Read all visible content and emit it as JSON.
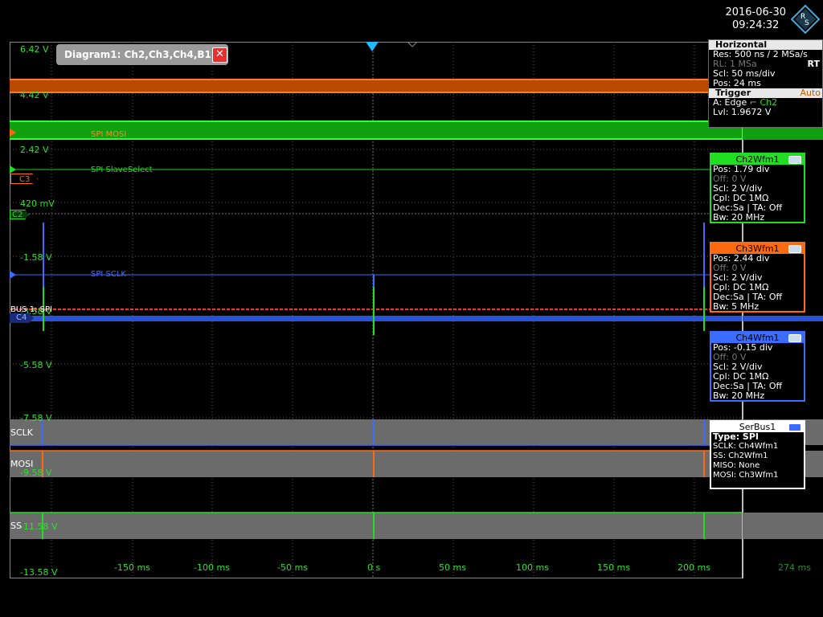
{
  "header": {
    "date": "2016-06-30",
    "time": "09:24:32"
  },
  "diagram": {
    "title": "Diagram1: Ch2,Ch3,Ch4,B1",
    "close_glyph": "✕"
  },
  "y_labels": [
    "6.42 V",
    "4.42 V",
    "2.42 V",
    "420 mV",
    "-1.58 V",
    "-3.58 V",
    "-5.58 V",
    "-7.58 V",
    "-9.58 V",
    "-11.58 V",
    "-13.58 V"
  ],
  "x_labels": [
    "-150 ms",
    "-100 ms",
    "-50 ms",
    "0 s",
    "50 ms",
    "100 ms",
    "150 ms",
    "200 ms",
    "274 ms"
  ],
  "wave_labels": {
    "mosi": "SPI MOSI",
    "slave_select": "SPI SlaveSelect",
    "sclk": "SPI SCLK",
    "bus": "BUS 1: SPI"
  },
  "markers": {
    "c3": "C3",
    "c2": "C2",
    "c4": "C4"
  },
  "bus_lanes": {
    "sclk": "SCLK",
    "mosi": "MOSI",
    "ss": "SS"
  },
  "horizontal": {
    "title": "Horizontal",
    "res": "Res: 500 ns / 2 MSa/s",
    "rl": "RL:  1 MSa",
    "rt": "RT",
    "scl": "Scl: 50 ms/div",
    "pos": "Pos: 24 ms"
  },
  "trigger": {
    "title": "Trigger",
    "mode": "Auto",
    "source": "A:   Edge",
    "channel": "Ch2",
    "level": "Lvl:  1.9672 V"
  },
  "ch2": {
    "title": "Ch2Wfm1",
    "pos": "Pos: 1.79 div",
    "off": "Off:  0 V",
    "scl": "Scl:  2 V/div",
    "cpl": "Cpl: DC 1MΩ",
    "dec": "Dec:Sa | TA: Off",
    "bw": "Bw: 20 MHz",
    "color": "#22dd22"
  },
  "ch3": {
    "title": "Ch3Wfm1",
    "pos": "Pos: 2.44 div",
    "off": "Off:  0 V",
    "scl": "Scl:  2 V/div",
    "cpl": "Cpl: DC 1MΩ",
    "dec": "Dec:Sa | TA: Off",
    "bw": "Bw: 5 MHz",
    "color": "#ff6a10"
  },
  "ch4": {
    "title": "Ch4Wfm1",
    "pos": "Pos: -0.15 div",
    "off": "Off:  0 V",
    "scl": "Scl:  2 V/div",
    "cpl": "Cpl: DC 1MΩ",
    "dec": "Dec:Sa | TA: Off",
    "bw": "Bw: 20 MHz",
    "color": "#3a6cff"
  },
  "serbus": {
    "title": "SerBus1",
    "type": "Type: SPI",
    "sclk": "SCLK: Ch4Wfm1",
    "ss": "SS:     Ch2Wfm1",
    "miso": "MISO: None",
    "mosi": "MOSI: Ch3Wfm1",
    "color": "#ffffff"
  }
}
